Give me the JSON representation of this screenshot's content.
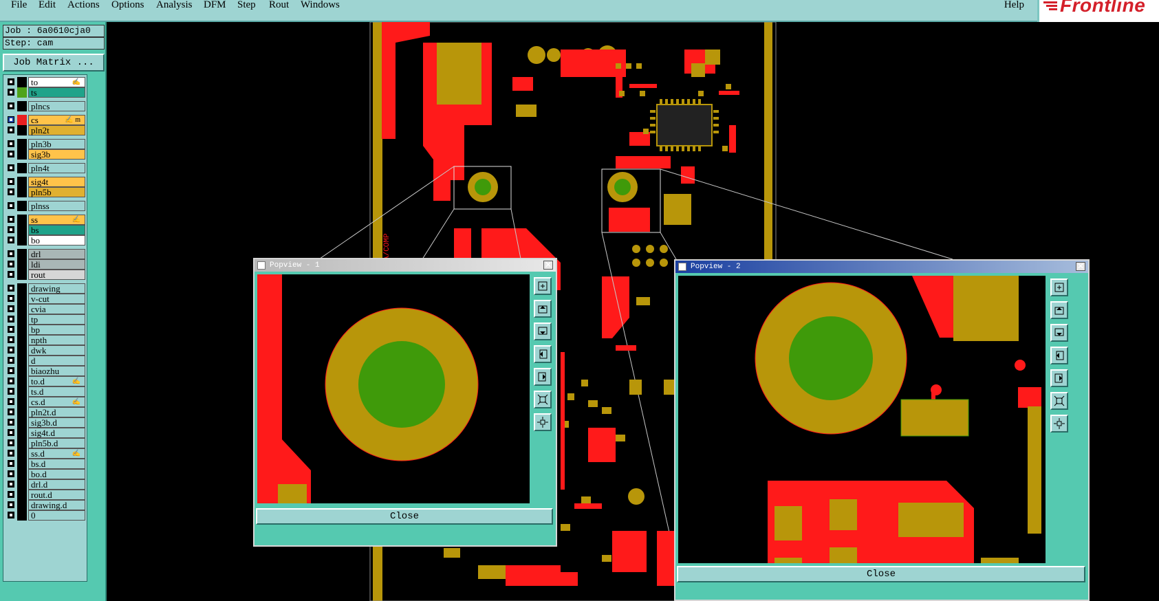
{
  "menubar": {
    "items": [
      "File",
      "Edit",
      "Actions",
      "Options",
      "Analysis",
      "DFM",
      "Step",
      "Rout",
      "Windows"
    ],
    "help": "Help",
    "logo_text": "Frontline"
  },
  "left_panel": {
    "job_line": "Job : 6a0610cja0",
    "step_line": "Step: cam",
    "job_matrix_button": "Job Matrix ...",
    "layers": [
      {
        "name": "to",
        "color": "#ffffff",
        "swatch": "#000000",
        "flag": "✍"
      },
      {
        "name": "ts",
        "color": "#1fa38a",
        "swatch": "#4fa31a",
        "flag": ""
      },
      {
        "name": "plncs",
        "color": "#9ed4d2",
        "swatch": "#000000",
        "flag": ""
      },
      {
        "name": "cs",
        "color": "#ffc34a",
        "swatch": "#e82020",
        "flag": "✍ m"
      },
      {
        "name": "pln2t",
        "color": "#e0b030",
        "swatch": "#000000",
        "flag": ""
      },
      {
        "name": "pln3b",
        "color": "#9ed4d2",
        "swatch": "#000000",
        "flag": ""
      },
      {
        "name": "sig3b",
        "color": "#ffc34a",
        "swatch": "#000000",
        "flag": ""
      },
      {
        "name": "pln4t",
        "color": "#9ed4d2",
        "swatch": "#000000",
        "flag": ""
      },
      {
        "name": "sig4t",
        "color": "#ffc34a",
        "swatch": "#000000",
        "flag": ""
      },
      {
        "name": "pln5b",
        "color": "#e0b030",
        "swatch": "#000000",
        "flag": ""
      },
      {
        "name": "plnss",
        "color": "#9ed4d2",
        "swatch": "#000000",
        "flag": ""
      },
      {
        "name": "ss",
        "color": "#ffc34a",
        "swatch": "#000000",
        "flag": "✍"
      },
      {
        "name": "bs",
        "color": "#1fa38a",
        "swatch": "#000000",
        "flag": ""
      },
      {
        "name": "bo",
        "color": "#ffffff",
        "swatch": "#000000",
        "flag": ""
      },
      {
        "name": "drl",
        "color": "#a9b7b6",
        "swatch": "#000000",
        "flag": ""
      },
      {
        "name": "ldi",
        "color": "#a9b7b6",
        "swatch": "#000000",
        "flag": ""
      },
      {
        "name": "rout",
        "color": "#d6d6d6",
        "swatch": "#000000",
        "flag": ""
      },
      {
        "name": "drawing",
        "color": "#9ed4d2",
        "swatch": "#000000",
        "flag": ""
      },
      {
        "name": "v-cut",
        "color": "#9ed4d2",
        "swatch": "#000000",
        "flag": ""
      },
      {
        "name": "cvia",
        "color": "#9ed4d2",
        "swatch": "#000000",
        "flag": ""
      },
      {
        "name": "tp",
        "color": "#9ed4d2",
        "swatch": "#000000",
        "flag": ""
      },
      {
        "name": "bp",
        "color": "#9ed4d2",
        "swatch": "#000000",
        "flag": ""
      },
      {
        "name": "npth",
        "color": "#9ed4d2",
        "swatch": "#000000",
        "flag": ""
      },
      {
        "name": "dwk",
        "color": "#9ed4d2",
        "swatch": "#000000",
        "flag": ""
      },
      {
        "name": "d",
        "color": "#9ed4d2",
        "swatch": "#000000",
        "flag": ""
      },
      {
        "name": "biaozhu",
        "color": "#9ed4d2",
        "swatch": "#000000",
        "flag": ""
      },
      {
        "name": "to.d",
        "color": "#9ed4d2",
        "swatch": "#000000",
        "flag": "✍"
      },
      {
        "name": "ts.d",
        "color": "#9ed4d2",
        "swatch": "#000000",
        "flag": ""
      },
      {
        "name": "cs.d",
        "color": "#9ed4d2",
        "swatch": "#000000",
        "flag": "✍"
      },
      {
        "name": "pln2t.d",
        "color": "#9ed4d2",
        "swatch": "#000000",
        "flag": ""
      },
      {
        "name": "sig3b.d",
        "color": "#9ed4d2",
        "swatch": "#000000",
        "flag": ""
      },
      {
        "name": "sig4t.d",
        "color": "#9ed4d2",
        "swatch": "#000000",
        "flag": ""
      },
      {
        "name": "pln5b.d",
        "color": "#9ed4d2",
        "swatch": "#000000",
        "flag": ""
      },
      {
        "name": "ss.d",
        "color": "#9ed4d2",
        "swatch": "#000000",
        "flag": "✍"
      },
      {
        "name": "bs.d",
        "color": "#9ed4d2",
        "swatch": "#000000",
        "flag": ""
      },
      {
        "name": "bo.d",
        "color": "#9ed4d2",
        "swatch": "#000000",
        "flag": ""
      },
      {
        "name": "drl.d",
        "color": "#9ed4d2",
        "swatch": "#000000",
        "flag": ""
      },
      {
        "name": "rout.d",
        "color": "#9ed4d2",
        "swatch": "#000000",
        "flag": ""
      },
      {
        "name": "drawing.d",
        "color": "#9ed4d2",
        "swatch": "#000000",
        "flag": ""
      },
      {
        "name": "0",
        "color": "#9ed4d2",
        "swatch": "#000000",
        "flag": ""
      }
    ]
  },
  "board": {
    "silkscreen_text": "1448IA/COMP",
    "colors": {
      "copper": "#b8960a",
      "trace": "#ff1a1a",
      "drill": "#3f9a0a",
      "background": "#000000"
    }
  },
  "popup1": {
    "title": "Popview - 1",
    "close_label": "Close"
  },
  "popup2": {
    "title": "Popview - 2",
    "close_label": "Close"
  },
  "popup_toolbar_icons": [
    "zoom-in-icon",
    "pan-up-icon",
    "pan-down-icon",
    "pan-left-icon",
    "pan-right-icon",
    "zoom-fit-icon",
    "zoom-out-icon"
  ]
}
